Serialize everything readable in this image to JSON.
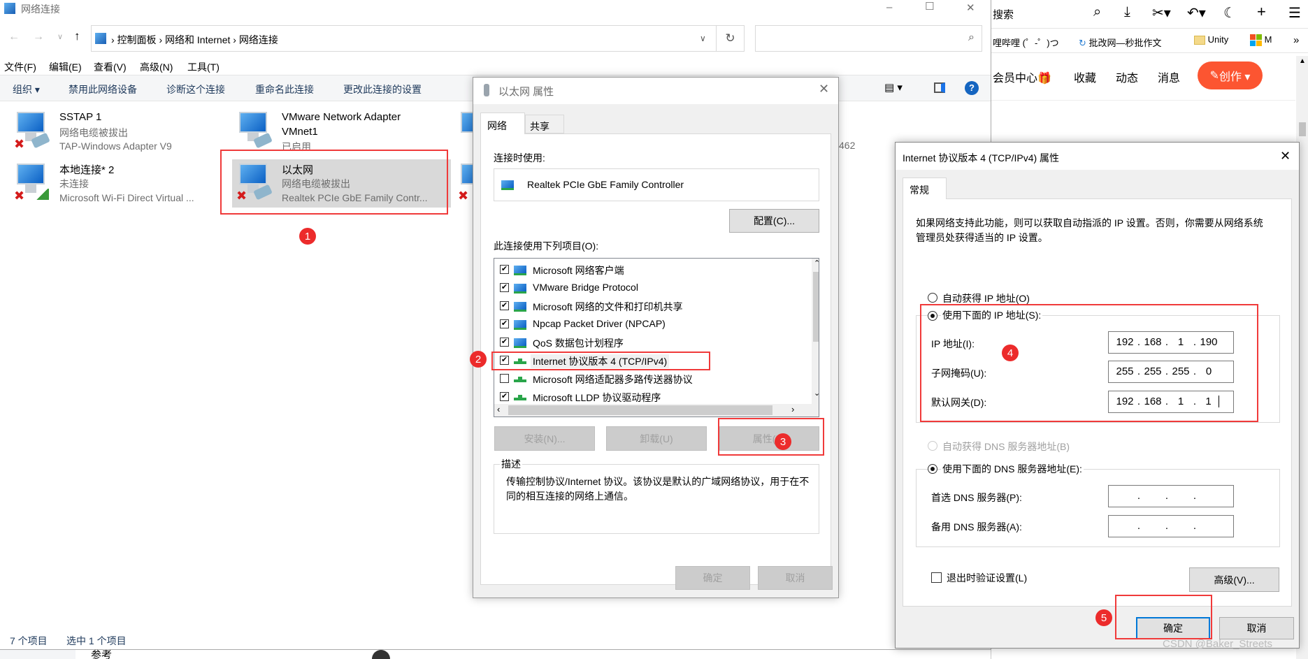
{
  "explorer": {
    "title": "网络连接",
    "window_controls": {
      "minimize": "–",
      "maximize": "☐",
      "close": "✕"
    },
    "breadcrumb": [
      "控制面板",
      "网络和 Internet",
      "网络连接"
    ],
    "search_placeholder": "",
    "menu": [
      "文件(F)",
      "编辑(E)",
      "查看(V)",
      "高级(N)",
      "工具(T)"
    ],
    "toolbar": {
      "organize": "组织 ▾",
      "items": [
        "禁用此网络设备",
        "诊断这个连接",
        "重命名此连接",
        "更改此连接的设置"
      ]
    },
    "connections": [
      {
        "name": "SSTAP 1",
        "status": "网络电缆被拔出",
        "device": "TAP-Windows Adapter V9"
      },
      {
        "name": "本地连接* 2",
        "status": "未连接",
        "device": "Microsoft Wi-Fi Direct Virtual ..."
      },
      {
        "name": "VMware Network Adapter",
        "name2": "VMnet1",
        "status": "已启用"
      },
      {
        "name": "以太网",
        "status": "网络电缆被拔出",
        "device": "Realtek PCIe GbE Family Contr...",
        "selected": true
      }
    ],
    "partial_text": "462",
    "status": {
      "count": "7 个项目",
      "selected": "选中 1 个项目"
    }
  },
  "browser": {
    "search_label": "搜索",
    "bookmarks": [
      "哩哔哩 (゜-゜)つ",
      "批改网—秒批作文",
      "Unity",
      "M",
      "»"
    ],
    "nav": [
      "会员中心",
      "收藏",
      "动态",
      "消息"
    ],
    "create_label": "创作 ▾",
    "below": {
      "ref": "参考"
    },
    "accent": "#fc5531"
  },
  "eth_dialog": {
    "title": "以太网 属性",
    "tabs": [
      "网络",
      "共享"
    ],
    "connect_using_label": "连接时使用:",
    "adapter": "Realtek PCIe GbE Family Controller",
    "configure": "配置(C)...",
    "items_label": "此连接使用下列项目(O):",
    "items": [
      {
        "label": "Microsoft 网络客户端",
        "checked": true,
        "icon": "nic"
      },
      {
        "label": "VMware Bridge Protocol",
        "checked": true,
        "icon": "nic"
      },
      {
        "label": "Microsoft 网络的文件和打印机共享",
        "checked": true,
        "icon": "nic"
      },
      {
        "label": "Npcap Packet Driver (NPCAP)",
        "checked": true,
        "icon": "nic"
      },
      {
        "label": "QoS 数据包计划程序",
        "checked": true,
        "icon": "nic"
      },
      {
        "label": "Internet 协议版本 4 (TCP/IPv4)",
        "checked": true,
        "icon": "proto"
      },
      {
        "label": "Microsoft 网络适配器多路传送器协议",
        "checked": false,
        "icon": "proto"
      },
      {
        "label": "Microsoft LLDP 协议驱动程序",
        "checked": true,
        "icon": "proto"
      }
    ],
    "install": "安装(N)...",
    "uninstall": "卸载(U)",
    "properties": "属性(R)",
    "desc_label": "描述",
    "description": "传输控制协议/Internet 协议。该协议是默认的广域网络协议，用于在不同的相互连接的网络上通信。",
    "ok": "确定",
    "cancel": "取消"
  },
  "ipv4_dialog": {
    "title": "Internet 协议版本 4 (TCP/IPv4) 属性",
    "tab": "常规",
    "intro": "如果网络支持此功能，则可以获取自动指派的 IP 设置。否则，你需要从网络系统管理员处获得适当的 IP 设置。",
    "auto_ip": "自动获得 IP 地址(O)",
    "manual_ip": "使用下面的 IP 地址(S):",
    "ip_label": "IP 地址(I):",
    "ip": [
      "192",
      "168",
      "1",
      "190"
    ],
    "mask_label": "子网掩码(U):",
    "mask": [
      "255",
      "255",
      "255",
      "0"
    ],
    "gw_label": "默认网关(D):",
    "gw": [
      "192",
      "168",
      "1",
      "1"
    ],
    "auto_dns": "自动获得 DNS 服务器地址(B)",
    "manual_dns": "使用下面的 DNS 服务器地址(E):",
    "dns1_label": "首选 DNS 服务器(P):",
    "dns2_label": "备用 DNS 服务器(A):",
    "validate": "退出时验证设置(L)",
    "advanced": "高级(V)...",
    "ok": "确定",
    "cancel": "取消",
    "selected_radio": {
      "ip": "manual",
      "dns": "manual"
    }
  },
  "steps": [
    "1",
    "2",
    "3",
    "4",
    "5"
  ],
  "watermark": "CSDN @Baker_Streets"
}
